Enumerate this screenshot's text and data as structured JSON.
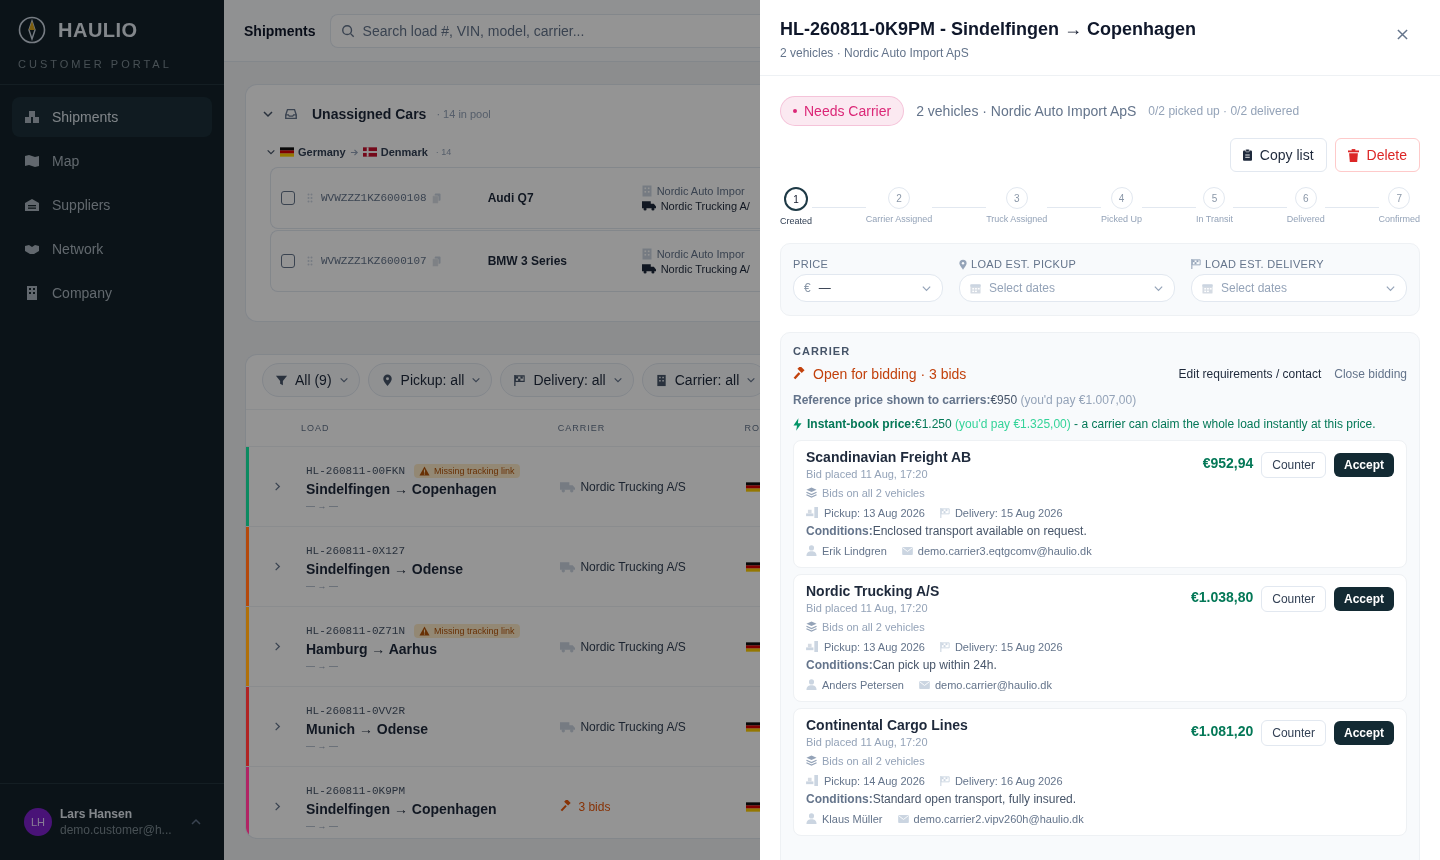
{
  "sidebar": {
    "logo": "HAULIO",
    "subtitle": "CUSTOMER PORTAL",
    "items": [
      {
        "label": "Shipments",
        "selected": true
      },
      {
        "label": "Map",
        "selected": false
      },
      {
        "label": "Suppliers",
        "selected": false
      },
      {
        "label": "Network",
        "selected": false
      },
      {
        "label": "Company",
        "selected": false
      }
    ],
    "user": {
      "initials": "LH",
      "name": "Lars Hansen",
      "email": "demo.customer@h..."
    }
  },
  "topbar": {
    "title": "Shipments",
    "search": {
      "placeholder": "Search load #, VIN, model, carrier..."
    }
  },
  "pool": {
    "title": "Unassigned Cars",
    "count": "· 14 in pool",
    "expanded": true,
    "group": {
      "from": "Germany",
      "to": "Denmark",
      "count": "· 14",
      "expanded": true
    },
    "vehicles": [
      {
        "vin": "WVWZZZ1KZ6000108",
        "model": "Audi Q7",
        "supplier": "Nordic Auto Impor",
        "carrier": "Nordic Trucking A/",
        "checked": false
      },
      {
        "vin": "WVWZZZ1KZ6000107",
        "model": "BMW 3 Series",
        "supplier": "Nordic Auto Impor",
        "carrier": "Nordic Trucking A/",
        "checked": false
      }
    ]
  },
  "loads": {
    "filters": [
      "All (9)",
      "Pickup: all",
      "Delivery: all",
      "Carrier: all"
    ],
    "columns": [
      "LOAD",
      "CARRIER",
      "RO"
    ],
    "rows": [
      {
        "id": "HL-260811-00FKN",
        "warning": "Missing tracking link",
        "route": "Sindelfingen → Copenhagen",
        "dates": "— → —",
        "kind": "assigned",
        "carrier": "Nordic Trucking A/S",
        "color": "#0c8a60",
        "expanded": false
      },
      {
        "id": "HL-260811-0X127",
        "route": "Sindelfingen → Odense",
        "dates": "— → —",
        "kind": "assigned",
        "carrier": "Nordic Trucking A/S",
        "color": "#b4490c",
        "expanded": false
      },
      {
        "id": "HL-260811-0Z71N",
        "warning": "Missing tracking link",
        "route": "Hamburg → Aarhus",
        "dates": "— → —",
        "kind": "assigned",
        "carrier": "Nordic Trucking A/S",
        "color": "#b0700a",
        "expanded": false
      },
      {
        "id": "HL-260811-0VV2R",
        "route": "Munich → Odense",
        "dates": "— → —",
        "kind": "assigned",
        "carrier": "Nordic Trucking A/S",
        "color": "#b02424",
        "expanded": false
      },
      {
        "id": "HL-260811-0K9PM",
        "route": "Sindelfingen → Copenhagen",
        "dates": "— → —",
        "kind": "bidding",
        "carrier": "3 bids",
        "color": "#b02464",
        "expanded": false
      }
    ]
  },
  "drawer": {
    "title": "HL-260811-0K9PM - Sindelfingen → Copenhagen",
    "subtitle": "2 vehicles · Nordic Auto Import ApS",
    "status": {
      "label": "Needs Carrier",
      "color": "#db2777"
    },
    "summary": "2 vehicles · Nordic Auto Import ApS",
    "progress": "0/2 picked up · 0/2 delivered",
    "actions": [
      {
        "label": "Copy list",
        "kind": "default"
      },
      {
        "label": "Delete",
        "kind": "danger"
      }
    ],
    "steps": [
      {
        "number": "1",
        "label": "Created",
        "current": true
      },
      {
        "number": "2",
        "label": "Carrier Assigned",
        "current": false
      },
      {
        "number": "3",
        "label": "Truck Assigned",
        "current": false
      },
      {
        "number": "4",
        "label": "Picked Up",
        "current": false
      },
      {
        "number": "5",
        "label": "In Transit",
        "current": false
      },
      {
        "number": "6",
        "label": "Delivered",
        "current": false
      },
      {
        "number": "7",
        "label": "Confirmed",
        "current": false
      }
    ],
    "fields": [
      {
        "kind": "price",
        "label": "PRICE",
        "prefix": "€",
        "value": "—"
      },
      {
        "kind": "pickup",
        "label": "LOAD EST. PICKUP",
        "placeholder": "Select dates"
      },
      {
        "kind": "delivery",
        "label": "LOAD EST. DELIVERY",
        "placeholder": "Select dates"
      }
    ],
    "carrier": {
      "heading": "CARRIER",
      "bidding": "Open for bidding · 3 bids",
      "links": [
        {
          "label": "Edit requirements / contact",
          "kind": "primary"
        },
        {
          "label": "Close bidding",
          "kind": "muted"
        }
      ],
      "reference": {
        "text": "**Reference price shown to carriers:**€950",
        "note": "(you'd pay €1.007,00)"
      },
      "instant": {
        "text": "**Instant-book price:**€1.250",
        "note": "(you'd pay €1.325,00)",
        "tail": "- a carrier can claim the whole load instantly at this price."
      },
      "bids": [
        {
          "carrier": "Scandinavian Freight AB",
          "placed": "Bid placed 11 Aug, 17:20",
          "scope": "Bids on all 2 vehicles",
          "pickup": "Pickup: 13 Aug 2026",
          "delivery": "Delivery: 15 Aug 2026",
          "conditions": "**Conditions:**Enclosed transport available on request.",
          "contact": "Erik Lindgren",
          "email": "demo.carrier3.eqtgcomv@haulio.dk",
          "price": "€952,94",
          "counter": "Counter",
          "accept": "Accept"
        },
        {
          "carrier": "Nordic Trucking A/S",
          "placed": "Bid placed 11 Aug, 17:20",
          "scope": "Bids on all 2 vehicles",
          "pickup": "Pickup: 13 Aug 2026",
          "delivery": "Delivery: 15 Aug 2026",
          "conditions": "**Conditions:**Can pick up within 24h.",
          "contact": "Anders Petersen",
          "email": "demo.carrier@haulio.dk",
          "price": "€1.038,80",
          "counter": "Counter",
          "accept": "Accept"
        },
        {
          "carrier": "Continental Cargo Lines",
          "placed": "Bid placed 11 Aug, 17:20",
          "scope": "Bids on all 2 vehicles",
          "pickup": "Pickup: 14 Aug 2026",
          "delivery": "Delivery: 16 Aug 2026",
          "conditions": "**Conditions:**Standard open transport, fully insured.",
          "contact": "Klaus Müller",
          "email": "demo.carrier2.vipv260h@haulio.dk",
          "price": "€1.081,20",
          "counter": "Counter",
          "accept": "Accept"
        }
      ]
    }
  }
}
